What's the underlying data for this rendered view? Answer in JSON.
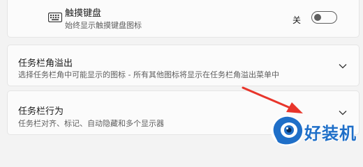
{
  "touch_keyboard": {
    "title": "触摸键盘",
    "subtitle": "始终显示触摸键盘图标",
    "toggle_state_label": "关",
    "toggle_on": false,
    "icon": "keyboard-icon"
  },
  "taskbar_corner_overflow": {
    "title": "任务栏角溢出",
    "subtitle": "选择任务栏角中可能显示的图标 - 所有其他图标将显示在任务栏角溢出菜单中",
    "icon": "chevron-down-icon"
  },
  "taskbar_behaviors": {
    "title": "任务栏行为",
    "subtitle": "任务栏对齐、标记、自动隐藏和多个显示器",
    "icon": "chevron-down-icon"
  },
  "watermark": {
    "text": "好装机",
    "color": "#1f6fc8"
  },
  "annotation_arrow_color": "#e8352b"
}
